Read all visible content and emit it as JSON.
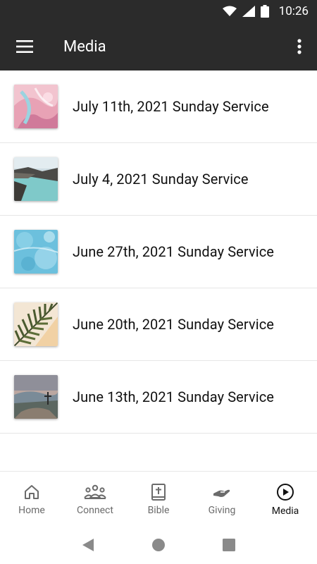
{
  "status_bar": {
    "time": "10:26"
  },
  "app_bar": {
    "title": "Media"
  },
  "media_items": [
    {
      "label": "July 11th, 2021 Sunday Service"
    },
    {
      "label": "July 4, 2021 Sunday Service"
    },
    {
      "label": "June 27th, 2021 Sunday Service"
    },
    {
      "label": "June 20th, 2021 Sunday Service"
    },
    {
      "label": "June 13th, 2021 Sunday Service"
    }
  ],
  "bottom_nav": [
    {
      "label": "Home",
      "icon": "home-icon",
      "active": false
    },
    {
      "label": "Connect",
      "icon": "people-icon",
      "active": false
    },
    {
      "label": "Bible",
      "icon": "bible-icon",
      "active": false
    },
    {
      "label": "Giving",
      "icon": "giving-hand-icon",
      "active": false
    },
    {
      "label": "Media",
      "icon": "play-circle-icon",
      "active": true
    }
  ],
  "colors": {
    "app_bar": "#2b2b2b",
    "active_nav": "#111111",
    "inactive_nav": "#6b6b6b"
  }
}
